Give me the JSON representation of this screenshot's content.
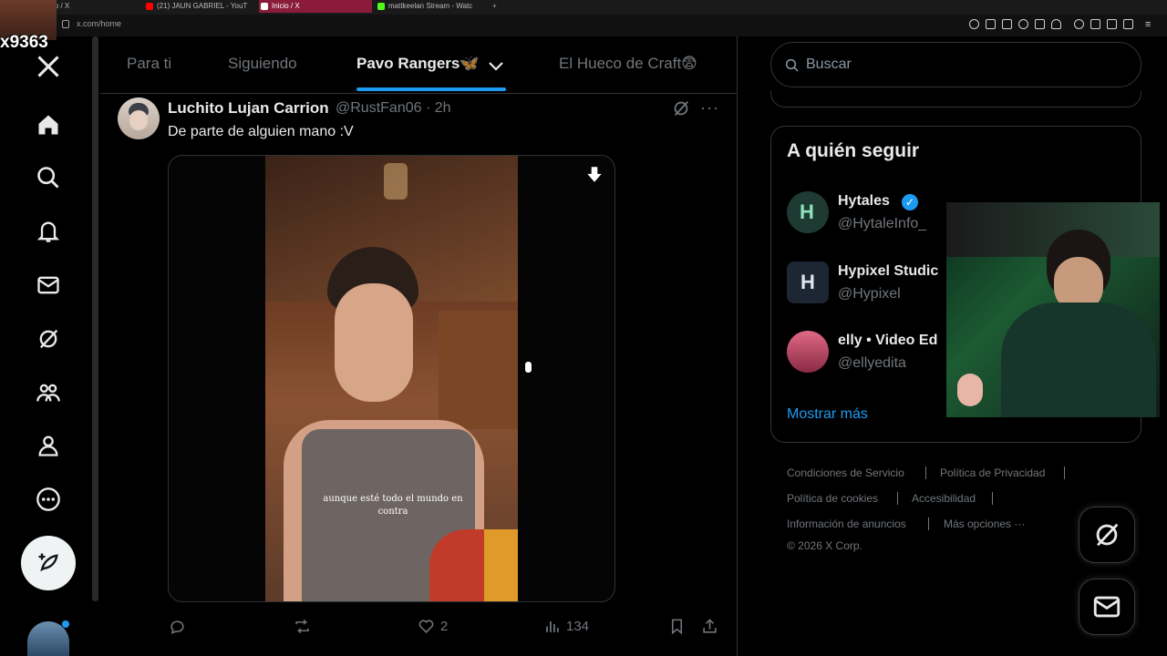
{
  "browser": {
    "tabs": [
      {
        "label": "cio / X",
        "color": "#555555"
      },
      {
        "label": "(21) JAUN GABRIEL - YouT",
        "color": "#ff0000"
      },
      {
        "label": "Inicio / X",
        "color": "#ffffff"
      },
      {
        "label": "mattkeelan Stream - Watc",
        "color": "#53fc18"
      }
    ],
    "url": "x.com/home"
  },
  "stream_overlay": {
    "viewer_tag": "x9363"
  },
  "nav": {
    "items": [
      "x-logo",
      "home",
      "explore",
      "notifications",
      "messages",
      "grok",
      "communities",
      "profile",
      "more"
    ]
  },
  "feed_tabs": [
    {
      "label": "Para ti"
    },
    {
      "label": "Siguiendo"
    },
    {
      "label": "Pavo Rangers🦋"
    },
    {
      "label": "El Hueco de Craft😨"
    }
  ],
  "tweet": {
    "name": "Luchito Lujan Carrion",
    "handle": "@RustFan06 · 2h",
    "text": "De parte de alguien mano :V",
    "video_subtitle": "aunque esté todo el mundo en contra",
    "likes": "2",
    "views": "134"
  },
  "search": {
    "placeholder": "Buscar"
  },
  "who_to_follow": {
    "title": "A quién seguir",
    "accounts": [
      {
        "name": "Hytales",
        "handle": "@HytaleInfo_",
        "verified": true,
        "avatar_color": "#1e3a32"
      },
      {
        "name": "Hypixel Studic",
        "handle": "@Hypixel",
        "verified": false,
        "avatar_color": "#1d2633"
      },
      {
        "name": "elly • Video Ed",
        "handle": "@ellyedita",
        "verified": false,
        "avatar_color": "#c64a66"
      }
    ],
    "show_more": "Mostrar más"
  },
  "footer": {
    "links": [
      "Condiciones de Servicio",
      "Política de Privacidad",
      "Política de cookies",
      "Accesibilidad",
      "Información de anuncios",
      "Más opciones ···"
    ],
    "copyright": "© 2026 X Corp."
  },
  "colors": {
    "accent": "#1d9bf0",
    "bg": "#000000",
    "muted": "#71767b",
    "border": "#2f3336"
  }
}
